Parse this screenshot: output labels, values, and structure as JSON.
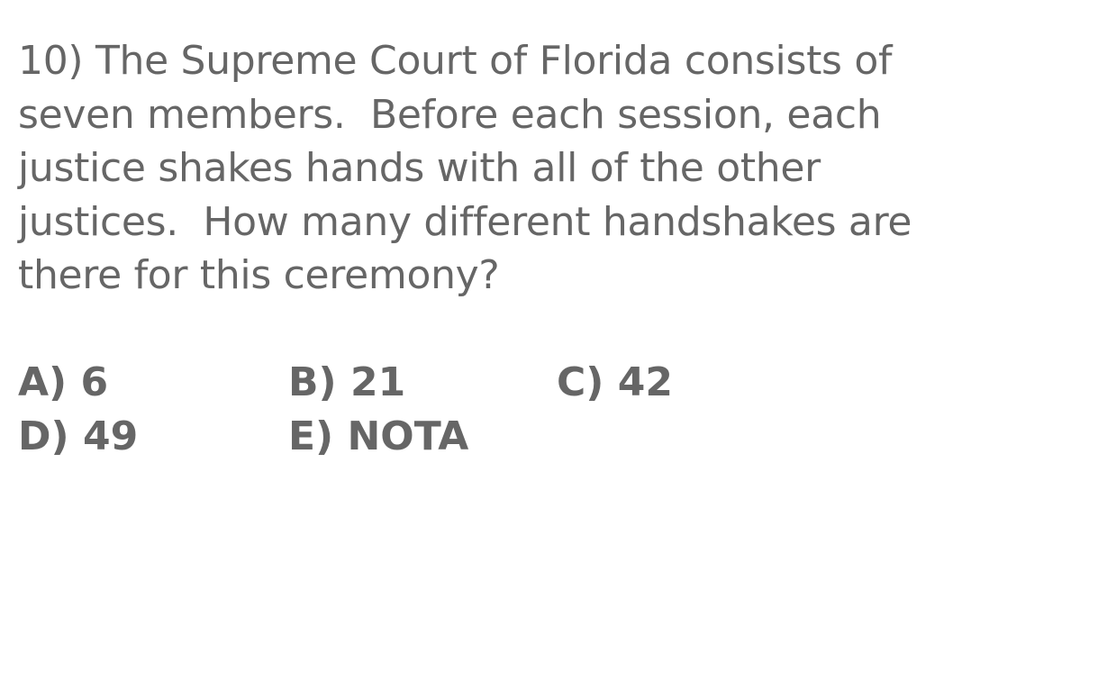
{
  "question": {
    "lines": [
      "10) The Supreme Court of Florida consists of",
      "seven members.  Before each session, each",
      "justice shakes hands with all of the other",
      "justices.  How many different handshakes are",
      "there for this ceremony?"
    ]
  },
  "choices": {
    "a": "A) 6",
    "b": "B) 21",
    "c": "C) 42",
    "d": "D) 49",
    "e": "E) NOTA"
  }
}
